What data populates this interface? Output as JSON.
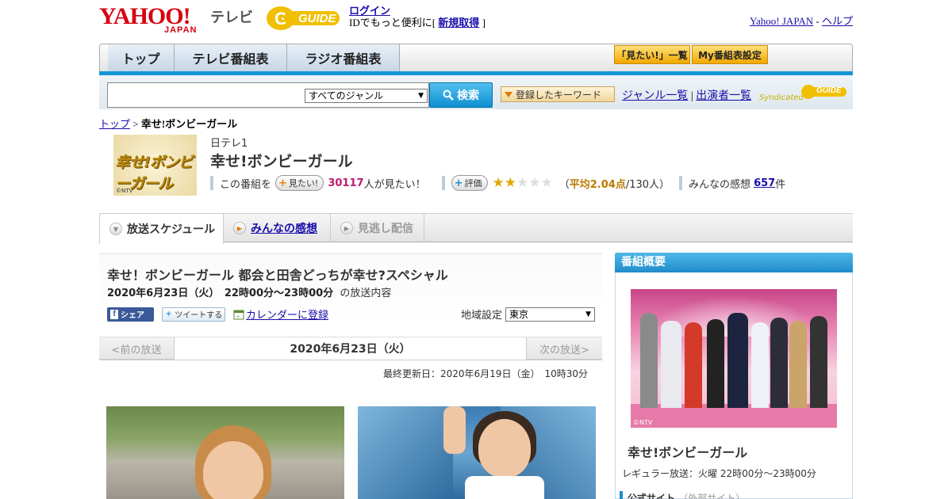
{
  "header": {
    "logo_text": "YAHOO!",
    "logo_sub": "JAPAN",
    "site_name": "テレビ",
    "gguide_text": "GUIDE",
    "login_label": "ログイン",
    "id_prompt_prefix": "IDでもっと便利に[ ",
    "register_label": "新規取得",
    "id_prompt_suffix": " ]",
    "yahoo_japan_link": "Yahoo! JAPAN",
    "separator": " - ",
    "help_link": "ヘルプ"
  },
  "nav": {
    "tabs": [
      {
        "label": "トップ"
      },
      {
        "label": "テレビ番組表"
      },
      {
        "label": "ラジオ番組表"
      }
    ],
    "mitai_list_label": "「見たい!」一覧",
    "my_settings_label": "My番組表設定"
  },
  "search": {
    "input_value": "",
    "genre_selected": "すべてのジャンル",
    "search_button_label": "検索",
    "keyword_button_label": "登録したキーワード",
    "genre_list_link": "ジャンル一覧",
    "link_separator": " | ",
    "performer_list_link": "出演者一覧",
    "syndicated_label": "Syndicated",
    "syndicated_brand": "GUIDE"
  },
  "breadcrumb": {
    "home": "トップ",
    "separator": " > ",
    "current": "幸せ!ボンビーガール"
  },
  "program": {
    "logo_text": "幸せ!ボンビーガール",
    "logo_credit": "©NTV",
    "channel": "日テレ1",
    "title": "幸せ!ボンビーガール",
    "mitai_prefix": "この番組を",
    "mitai_button": "見たい!",
    "mitai_count": "30117",
    "mitai_suffix": "人が見たい！",
    "rating_button": "評価",
    "rating_avg": 2.04,
    "rating_open": "（",
    "rating_avg_label": "平均2.04点",
    "rating_count_label": "/130人）",
    "impressions_label": "みんなの感想",
    "impressions_count": "657",
    "impressions_suffix": "件"
  },
  "subtabs": [
    {
      "label": "放送スケジュール",
      "active": true
    },
    {
      "label": "みんなの感想",
      "active": false
    },
    {
      "label": "見逃し配信",
      "active": false
    }
  ],
  "episode": {
    "title": "幸せ！ボンビーガール 都会と田舎どっちが幸せ?スペシャル",
    "datetime": "2020年6月23日（火）　22時00分～23時00分",
    "datetime_suffix": "の放送内容",
    "share_label": "シェア",
    "tweet_label": "ツイートする",
    "calendar_label": "カレンダーに登録",
    "region_label": "地域設定",
    "region_value": "東京",
    "prev_label": "<前の放送",
    "current_date": "2020年6月23日（火）",
    "next_label": "次の放送>",
    "updated": "最終更新日：2020年6月19日（金）　10時30分"
  },
  "sidebar": {
    "heading": "番組概要",
    "photo_credit": "©NTV",
    "title": "幸せ!ボンビーガール",
    "regular": "レギュラー放送：火曜 22時00分～23時00分",
    "official_label": "公式サイト",
    "official_note": "（外部サイト）"
  },
  "colors": {
    "accent_blue": "#1597d6",
    "yahoo_red": "#d7000f",
    "mitai_pink": "#c01970",
    "star_gold": "#e2a900"
  }
}
